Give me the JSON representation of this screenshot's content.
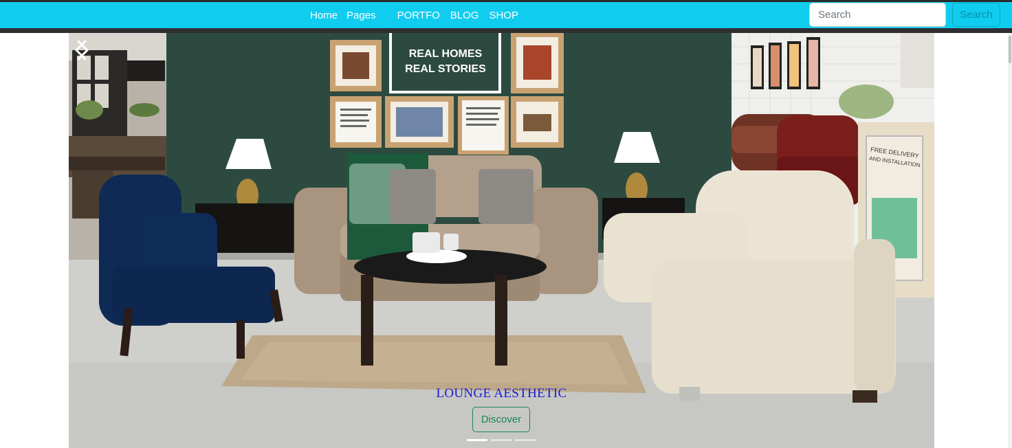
{
  "nav": {
    "links": [
      "Home",
      "Pages",
      "PORTFO",
      "BLOG",
      "SHOP"
    ]
  },
  "search": {
    "placeholder": "Search",
    "button_label": "Search"
  },
  "carousel": {
    "wall_sign_line1": "REAL HOMES",
    "wall_sign_line2": "REAL STORIES",
    "counter_sign_line1": "FREE DELIVERY",
    "counter_sign_line2": "AND INSTALLATION",
    "caption_title": "LOUNGE AESTHETIC",
    "caption_button": "Discover",
    "slide_count": 3,
    "active_slide": 1
  },
  "colors": {
    "navbar": "#10cdf0",
    "caption_title": "#1a1ad6",
    "discover_button": "#198754"
  }
}
